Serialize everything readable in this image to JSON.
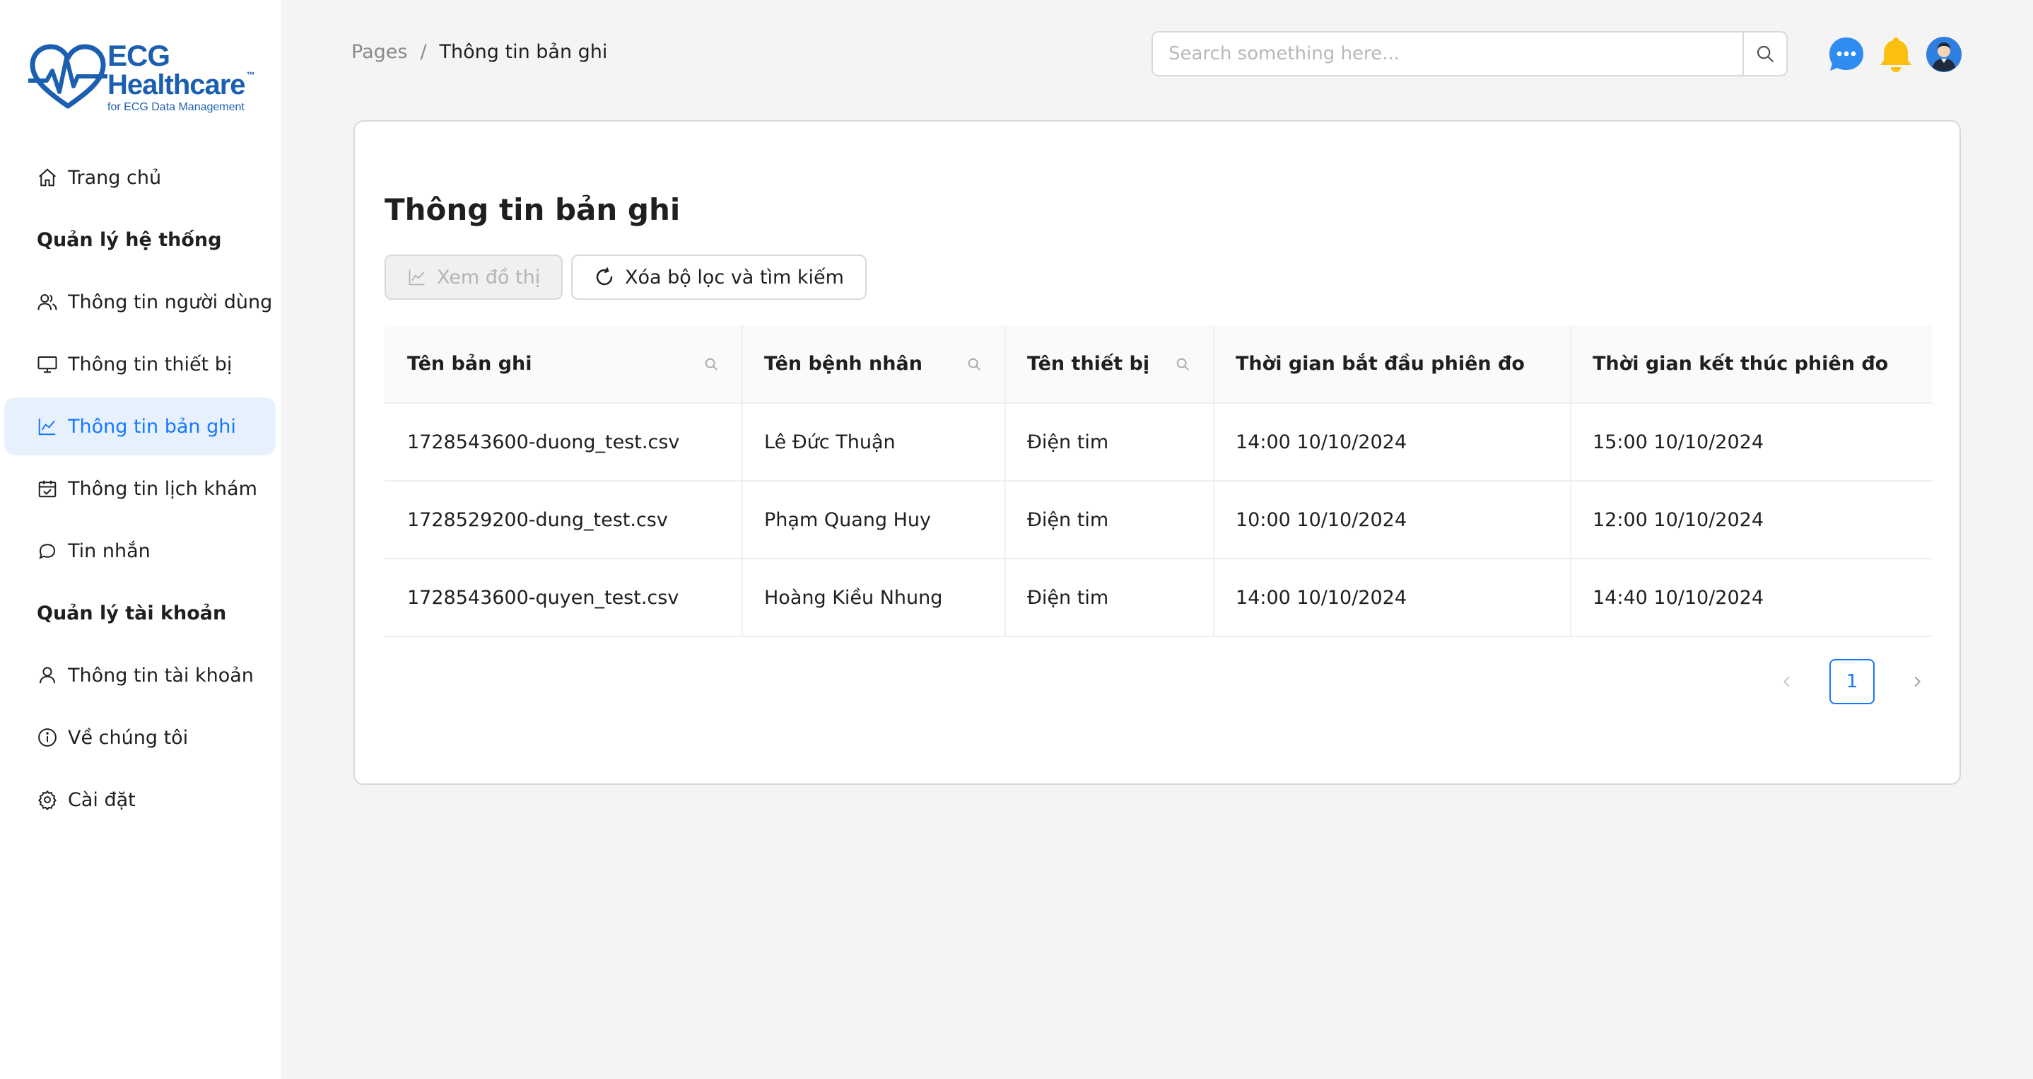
{
  "brand": {
    "line1": "ECG",
    "line2": "Healthcare",
    "tm": "™",
    "tagline": "for ECG Data Management"
  },
  "sidebar": {
    "items": [
      {
        "label": "Trang chủ",
        "icon": "home-icon"
      },
      {
        "group": "Quản lý hệ thống"
      },
      {
        "label": "Thông tin người dùng",
        "icon": "users-icon"
      },
      {
        "label": "Thông tin thiết bị",
        "icon": "monitor-icon"
      },
      {
        "label": "Thông tin bản ghi",
        "icon": "line-chart-icon",
        "active": true
      },
      {
        "label": "Thông tin lịch khám",
        "icon": "calendar-icon"
      },
      {
        "label": "Tin nhắn",
        "icon": "chat-icon"
      },
      {
        "group": "Quản lý tài khoản"
      },
      {
        "label": "Thông tin tài khoản",
        "icon": "user-icon"
      },
      {
        "label": "Về chúng tôi",
        "icon": "info-icon"
      },
      {
        "label": "Cài đặt",
        "icon": "gear-icon"
      }
    ]
  },
  "header": {
    "breadcrumb_root": "Pages",
    "breadcrumb_sep": "/",
    "breadcrumb_current": "Thông tin bản ghi",
    "search_placeholder": "Search something here...",
    "accent": "#1677ff",
    "bell_color": "#fbbf12"
  },
  "main": {
    "title": "Thông tin bản ghi",
    "view_chart_label": "Xem đồ thị",
    "reset_label": "Xóa bộ lọc và tìm kiếm",
    "columns": [
      "Tên bản ghi",
      "Tên bệnh nhân",
      "Tên thiết bị",
      "Thời gian bắt đầu phiên đo",
      "Thời gian kết thúc phiên đo"
    ],
    "rows": [
      [
        "1728543600-duong_test.csv",
        "Lê Đức Thuận",
        "Điện tim",
        "14:00 10/10/2024",
        "15:00 10/10/2024"
      ],
      [
        "1728529200-dung_test.csv",
        "Phạm Quang Huy",
        "Điện tim",
        "10:00 10/10/2024",
        "12:00 10/10/2024"
      ],
      [
        "1728543600-quyen_test.csv",
        "Hoàng Kiều Nhung",
        "Điện tim",
        "14:00 10/10/2024",
        "14:40 10/10/2024"
      ]
    ],
    "page": "1"
  }
}
